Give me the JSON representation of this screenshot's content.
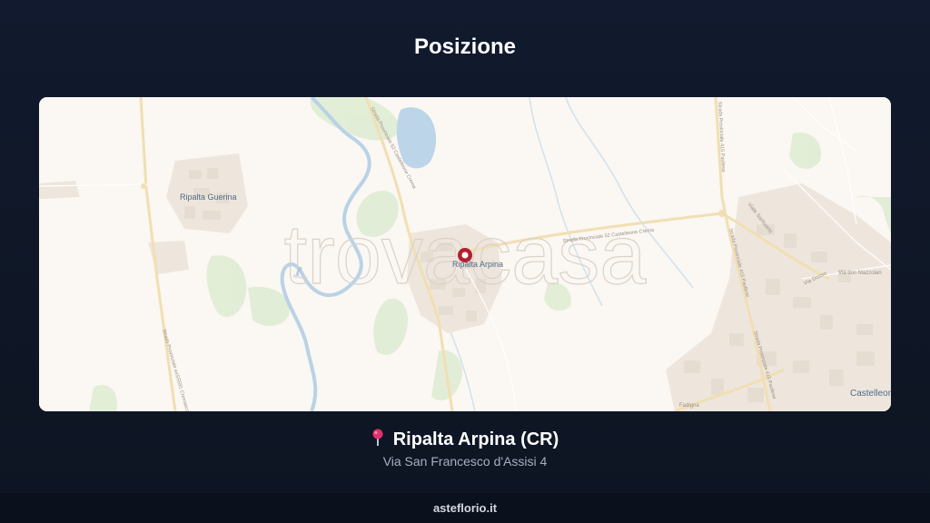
{
  "header": {
    "title": "Posizione"
  },
  "map": {
    "watermark": "trovacasa",
    "marker_color": "#b3202f",
    "labels": {
      "ripalta_guerina": "Ripalta Guerina",
      "ripalta_arpina": "Ripalta Arpina",
      "castelleone": "Castelleon",
      "sp52_north": "Strada Provinciale 52 Castelleone Crema",
      "sp52_east": "Strada Provinciale 52 Castelleone Crema",
      "sp415_north": "Strada Provinciale 415 Paullese",
      "sp415_mid": "Strada Provinciale 415 Paullese",
      "sp415_south": "Strada Provinciale 415 Paullese",
      "sp591": "Strada Provinciale exSS591 Cremasca",
      "viale_santuario": "Viale Santuario",
      "via_dosso": "Via Dosso",
      "via_don_mazzolari": "Via don Mazzolari",
      "serio": "Serio",
      "via_fadigna": "Fadigna"
    }
  },
  "location": {
    "pin_icon": "round-pushpin",
    "name": "Ripalta Arpina (CR)",
    "address": "Via San Francesco d'Assisi 4"
  },
  "footer": {
    "site": "asteflorio.it"
  }
}
